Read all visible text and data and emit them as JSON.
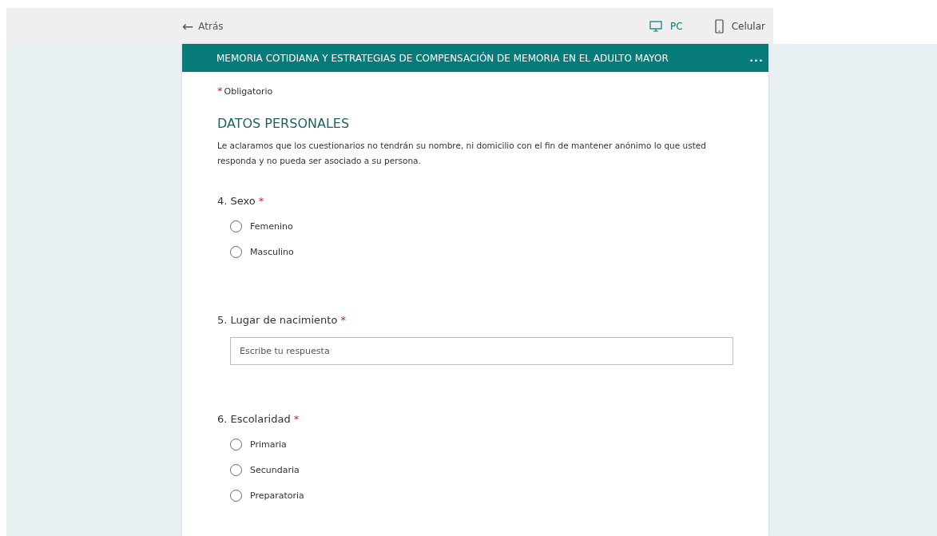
{
  "top_bar": {
    "back": {
      "icon": "←",
      "label": "Atrás"
    },
    "views": [
      {
        "label": "PC",
        "kind": "desktop",
        "selected": true
      },
      {
        "label": "Celular",
        "kind": "phone",
        "selected": false
      }
    ]
  },
  "form": {
    "title": "MEMORIA COTIDIANA Y ESTRATEGIAS DE COMPENSACIÓN DE MEMORIA EN EL ADULTO MAYOR",
    "menu": "...",
    "required_note": {
      "mark": "*",
      "label": "Obligatorio"
    },
    "section": {
      "title": "DATOS PERSONALES",
      "description": "Le aclaramos que los cuestionarios no tendrán su nombre, ni domicilio con el fin de mantener anónimo lo que usted responda y no pueda ser asociado a su persona."
    },
    "questions": [
      {
        "number": "4.",
        "label": "Sexo",
        "mark": "*",
        "kind": "choice",
        "options": [
          {
            "label": "Femenino",
            "selected": false
          },
          {
            "label": "Masculino",
            "selected": false
          }
        ]
      },
      {
        "number": "5.",
        "label": "Lugar de nacimiento",
        "mark": "*",
        "kind": "text",
        "placeholder": "Escribe tu respuesta"
      },
      {
        "number": "6.",
        "label": "Escolaridad",
        "mark": "*",
        "kind": "choice",
        "options": [
          {
            "label": "Primaria",
            "selected": false
          },
          {
            "label": "Secundaria",
            "selected": false
          },
          {
            "label": "Preparatoria",
            "selected": false
          }
        ]
      }
    ]
  }
}
